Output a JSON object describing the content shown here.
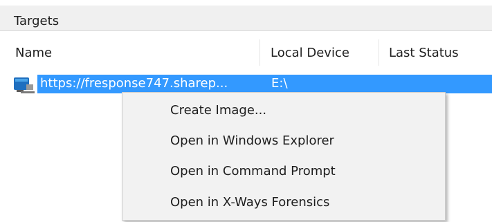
{
  "panel": {
    "title": "Targets"
  },
  "columns": {
    "name": "Name",
    "local_device": "Local Device",
    "last_status": "Last Status"
  },
  "rows": [
    {
      "icon": "network-drive-icon",
      "name": "https://fresponse747.sharep...",
      "local_device": "E:\\",
      "last_status": ""
    }
  ],
  "context_menu": {
    "items": [
      {
        "label": "Create Image..."
      },
      {
        "label": "Open in Windows Explorer"
      },
      {
        "label": "Open in Command Prompt"
      },
      {
        "label": "Open in X-Ways Forensics"
      }
    ]
  },
  "colors": {
    "selection": "#3399ff",
    "header_bg": "#f0f0f0",
    "menu_bg": "#f2f2f2"
  }
}
